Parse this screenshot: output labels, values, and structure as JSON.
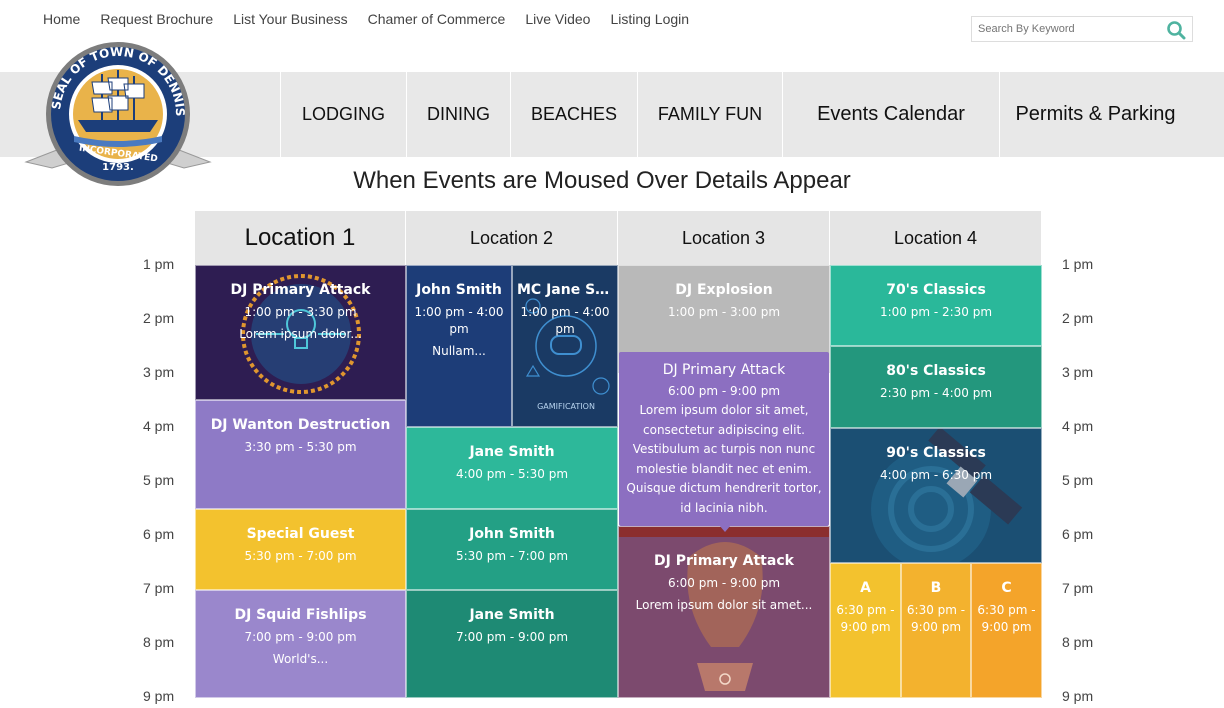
{
  "toplinks": [
    "Home",
    "Request Brochure",
    "List Your Business",
    "Chamer of Commerce",
    "Live Video",
    "Listing Login"
  ],
  "search": {
    "placeholder": "Search By Keyword"
  },
  "mainnav": [
    "LODGING",
    "DINING",
    "BEACHES",
    "FAMILY FUN",
    "Events Calendar",
    "Permits & Parking"
  ],
  "seal": {
    "text": "SEAL OF TOWN OF DENNIS, MASS",
    "incorporated": "INCORPORATED",
    "year": "1793."
  },
  "page_title": "When Events are Moused Over Details Appear",
  "locations": [
    "Location 1",
    "Location 2",
    "Location 3",
    "Location 4"
  ],
  "times": [
    "1 pm",
    "2 pm",
    "3 pm",
    "4 pm",
    "5 pm",
    "6 pm",
    "7 pm",
    "8 pm",
    "9 pm"
  ],
  "events": {
    "l1_primary_attack": {
      "title": "DJ Primary Attack",
      "time": "1:00 pm - 3:30 pm",
      "desc": "Lorem ipsum dolor..."
    },
    "l1_wanton": {
      "title": "DJ Wanton Destruction",
      "time": "3:30 pm - 5:30 pm"
    },
    "l1_special_guest": {
      "title": "Special Guest",
      "time": "5:30 pm - 7:00 pm"
    },
    "l1_squid": {
      "title": "DJ Squid Fishlips",
      "time": "7:00 pm - 9:00 pm",
      "desc": "World's..."
    },
    "l2_john_smith": {
      "title": "John Smith",
      "time": "1:00 pm - 4:00 pm",
      "desc": "Nullam..."
    },
    "l2_mc_jane": {
      "title": "MC Jane Sm...",
      "time": "1:00 pm - 4:00 pm",
      "label": "GAMIFICATION"
    },
    "l2_jane_smith_1": {
      "title": "Jane Smith",
      "time": "4:00 pm - 5:30 pm"
    },
    "l2_john_smith_2": {
      "title": "John Smith",
      "time": "5:30 pm - 7:00 pm"
    },
    "l2_jane_smith_2": {
      "title": "Jane Smith",
      "time": "7:00 pm - 9:00 pm"
    },
    "l3_explosion": {
      "title": "DJ Explosion",
      "time": "1:00 pm - 3:00 pm"
    },
    "l3_primary_attack": {
      "title": "DJ Primary Attack",
      "time": "6:00 pm - 9:00 pm",
      "desc": "Lorem ipsum dolor sit amet..."
    },
    "l4_70s": {
      "title": "70's Classics",
      "time": "1:00 pm - 2:30 pm"
    },
    "l4_80s": {
      "title": "80's Classics",
      "time": "2:30 pm - 4:00 pm"
    },
    "l4_90s": {
      "title": "90's Classics",
      "time": "4:00 pm - 6:30 pm"
    },
    "l4_a": {
      "title": "A",
      "time": "6:30 pm - 9:00 pm"
    },
    "l4_b": {
      "title": "B",
      "time": "6:30 pm - 9:00 pm"
    },
    "l4_c": {
      "title": "C",
      "time": "6:30 pm - 9:00 pm"
    }
  },
  "popup": {
    "title": "DJ Primary Attack",
    "time": "6:00 pm - 9:00 pm",
    "desc": "Lorem ipsum dolor sit amet, consectetur adipiscing elit. Vestibulum ac turpis non nunc molestie blandit nec et enim. Quisque dictum hendrerit tortor, id lacinia nibh."
  },
  "colors": {
    "dark_purple": "#2e1d52",
    "purple": "#8e7ac6",
    "yellow": "#f3c22e",
    "lavender": "#9a87cc",
    "navy": "#1d3d78",
    "teal": "#2db89a",
    "dark_teal": "#1e8a74",
    "gray": "#b9b9b9",
    "mauve": "#7c4a6e",
    "green": "#2ab89a",
    "slate": "#1b4f73",
    "orange": "#f4a42a"
  }
}
